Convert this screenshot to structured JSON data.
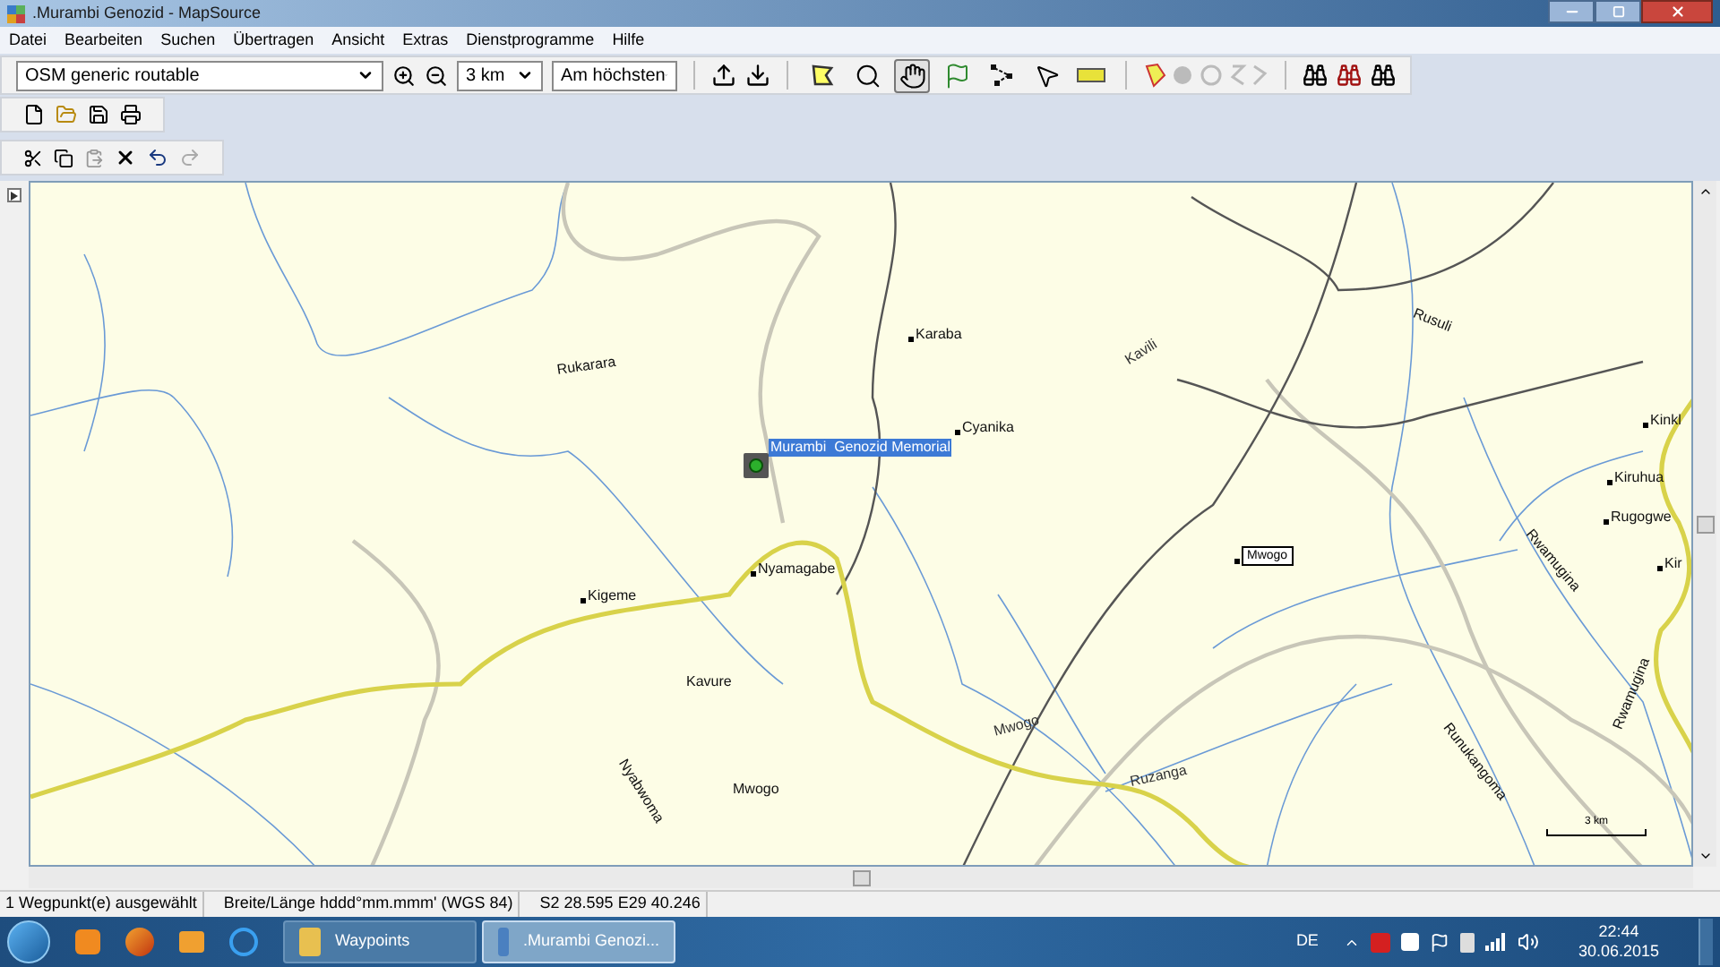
{
  "window": {
    "title": ".Murambi Genozid - MapSource"
  },
  "menu": [
    "Datei",
    "Bearbeiten",
    "Suchen",
    "Übertragen",
    "Ansicht",
    "Extras",
    "Dienstprogramme",
    "Hilfe"
  ],
  "toolbar": {
    "map_product": "OSM generic routable",
    "zoom_scale": "3 km",
    "detail": "Am höchsten"
  },
  "map_tools": [
    {
      "kind": "area",
      "selected": false
    },
    {
      "kind": "zoom",
      "selected": false
    },
    {
      "kind": "hand",
      "selected": true
    },
    {
      "kind": "flag",
      "selected": false
    },
    {
      "kind": "route",
      "selected": false
    },
    {
      "kind": "pointer",
      "selected": false
    },
    {
      "kind": "ruler",
      "selected": false
    }
  ],
  "map": {
    "waypoint": {
      "label": "Murambi  Genozid Memorial",
      "selected": true
    },
    "labels": [
      {
        "text": "Rukarara",
        "kind": "river"
      },
      {
        "text": "Karaba",
        "kind": "place"
      },
      {
        "text": "Cyanika",
        "kind": "place"
      },
      {
        "text": "Kavili",
        "kind": "road"
      },
      {
        "text": "Rusuli",
        "kind": "river"
      },
      {
        "text": "Nyamagabe",
        "kind": "place"
      },
      {
        "text": "Kigeme",
        "kind": "place"
      },
      {
        "text": "Kavure",
        "kind": "river"
      },
      {
        "text": "Nyabwoma",
        "kind": "river"
      },
      {
        "text": "Mwogo",
        "kind": "river"
      },
      {
        "text": "Mwogo",
        "kind": "road"
      },
      {
        "text": "Ruzanga",
        "kind": "road"
      },
      {
        "text": "Mwogo",
        "kind": "boxed"
      },
      {
        "text": "Kinkl",
        "kind": "place"
      },
      {
        "text": "Kiruhua",
        "kind": "place"
      },
      {
        "text": "Rugogwe",
        "kind": "place"
      },
      {
        "text": "Kir",
        "kind": "place"
      },
      {
        "text": "Rwamugina",
        "kind": "river"
      },
      {
        "text": "Runukangoma",
        "kind": "river"
      },
      {
        "text": "Rwamugina",
        "kind": "river"
      }
    ],
    "scale": "3 km"
  },
  "status_bar": [
    "1 Wegpunkt(e) ausgewählt",
    "Breite/Länge hddd°mm.mmm' (WGS 84)",
    "S2 28.595 E29 40.246"
  ],
  "taskbar": {
    "items": [
      {
        "label": "Waypoints",
        "selected": false
      },
      {
        "label": ".Murambi Genozi...",
        "selected": true
      }
    ],
    "language": "DE",
    "time": "22:44",
    "date": "30.06.2015"
  }
}
